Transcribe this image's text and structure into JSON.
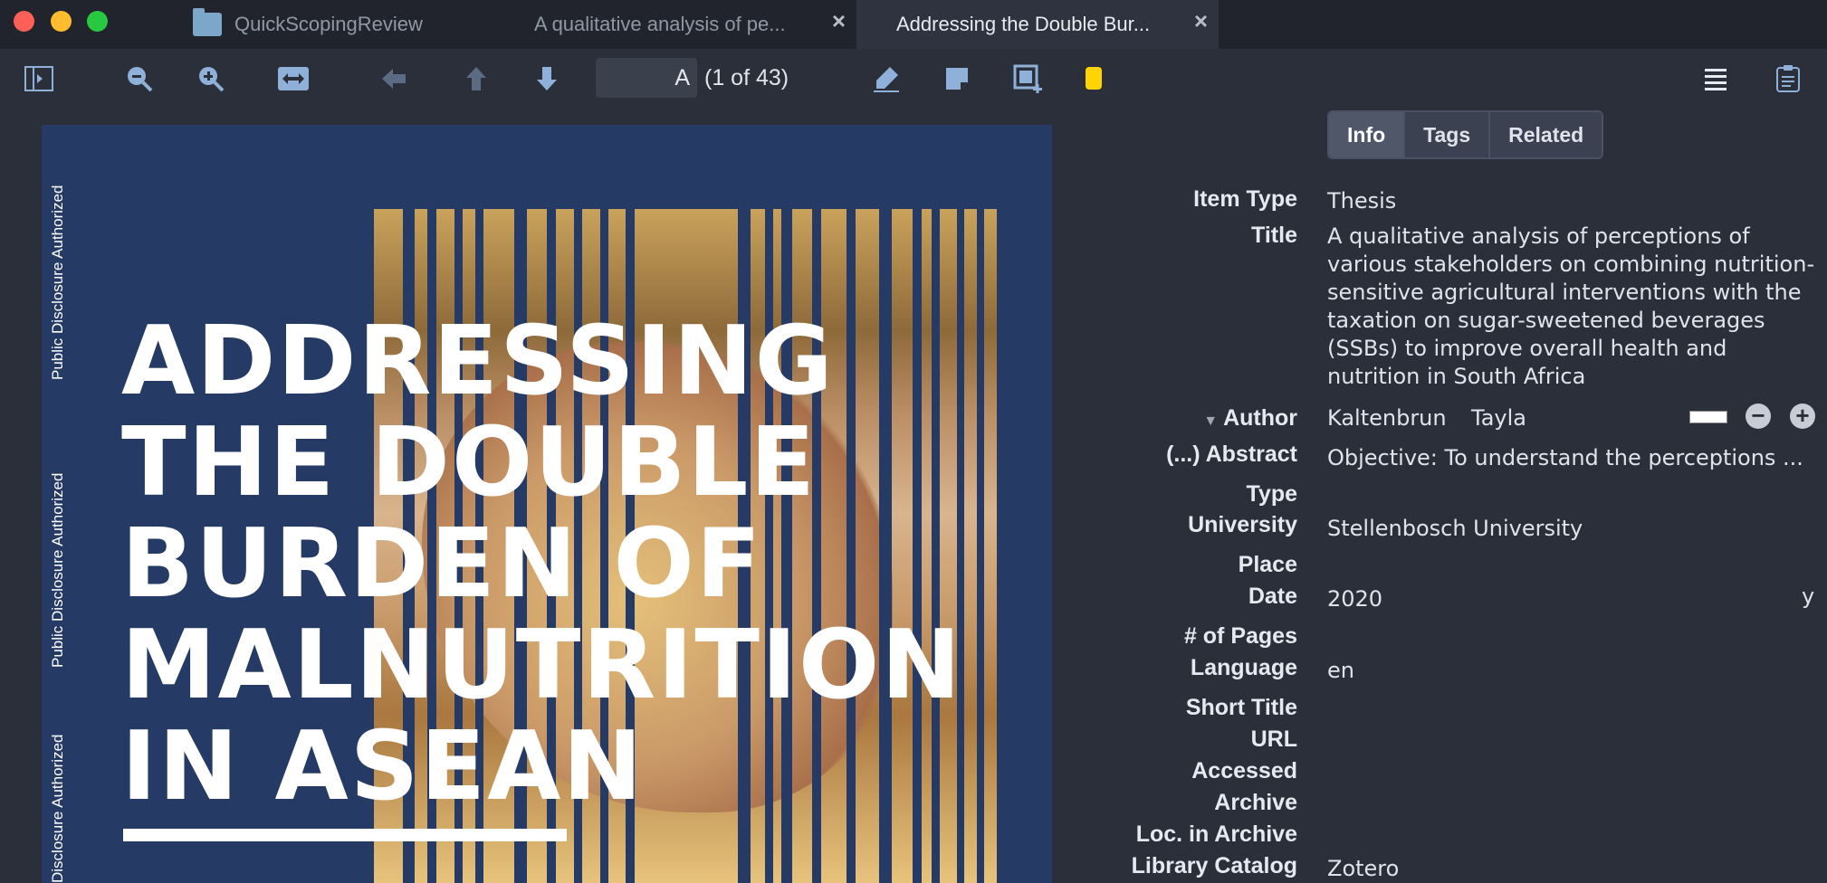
{
  "tabs": [
    {
      "label": "QuickScopingReview"
    },
    {
      "label": "A qualitative analysis of pe..."
    },
    {
      "label": "Addressing the Double Bur..."
    }
  ],
  "toolbar": {
    "page_value": "A",
    "page_count": "(1 of 43)"
  },
  "document": {
    "side_labels": [
      "Public Disclosure Authorized",
      "Public Disclosure Authorized",
      "Disclosure Authorized"
    ],
    "cover_title": [
      "ADDRESSING",
      "THE DOUBLE",
      "BURDEN OF",
      "MALNUTRITION",
      "IN ASEAN"
    ]
  },
  "info_tabs": {
    "info": "Info",
    "tags": "Tags",
    "related": "Related"
  },
  "fields": {
    "item_type_label": "Item Type",
    "item_type": "Thesis",
    "title_label": "Title",
    "title": "A qualitative analysis of perceptions of various stakeholders on combining nutrition-sensitive agricultural interventions with the taxation on sugar-sweetened beverages (SSBs) to improve overall health and nutrition in South Africa",
    "author_label": "Author",
    "author_last": "Kaltenbrun",
    "author_first": "Tayla",
    "abstract_label": "(...) Abstract",
    "abstract": "Objective: To understand the perceptions ...",
    "type_label": "Type",
    "university_label": "University",
    "university": "Stellenbosch University",
    "place_label": "Place",
    "date_label": "Date",
    "date": "2020",
    "date_flag": "y",
    "pages_label": "# of Pages",
    "language_label": "Language",
    "language": "en",
    "short_title_label": "Short Title",
    "url_label": "URL",
    "accessed_label": "Accessed",
    "archive_label": "Archive",
    "loc_archive_label": "Loc. in Archive",
    "library_catalog_label": "Library Catalog",
    "library_catalog": "Zotero"
  }
}
